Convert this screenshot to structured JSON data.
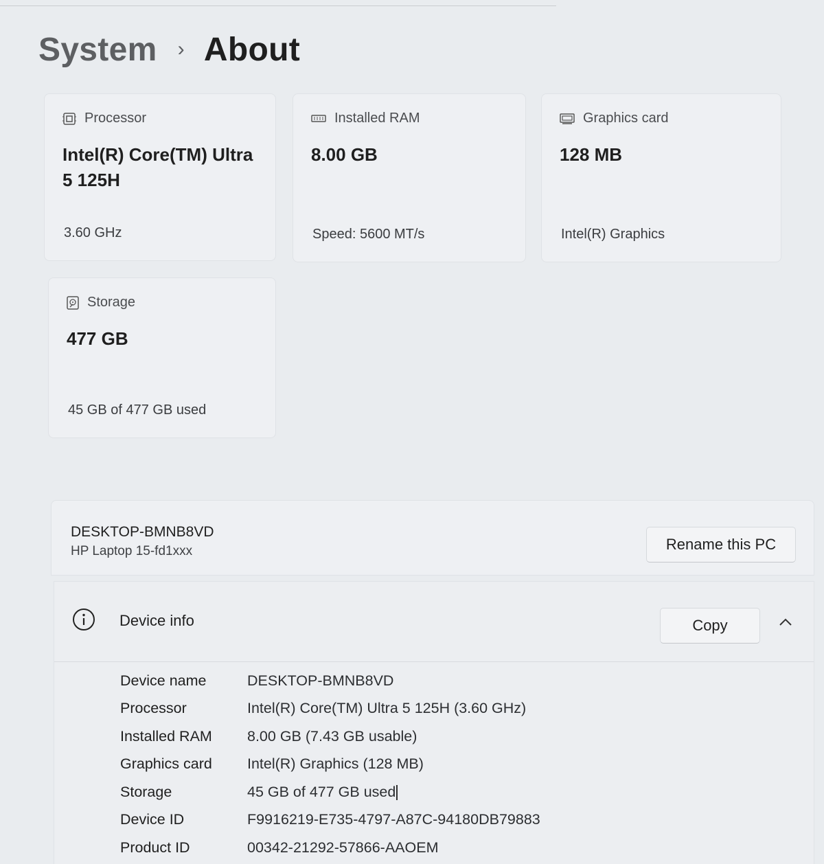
{
  "breadcrumb": {
    "parent": "System",
    "separator": "›",
    "current": "About"
  },
  "specs_cards": [
    {
      "icon": "processor-icon",
      "label": "Processor",
      "value": "Intel(R) Core(TM) Ultra 5 125H",
      "sub": "3.60 GHz"
    },
    {
      "icon": "ram-icon",
      "label": "Installed RAM",
      "value": "8.00 GB",
      "sub": "Speed: 5600 MT/s"
    },
    {
      "icon": "graphics-card-icon",
      "label": "Graphics card",
      "value": "128 MB",
      "sub": "Intel(R) Graphics"
    },
    {
      "icon": "storage-icon",
      "label": "Storage",
      "value": "477 GB",
      "sub": "45 GB of 477 GB used"
    }
  ],
  "pc": {
    "name": "DESKTOP-BMNB8VD",
    "model": "HP Laptop 15-fd1xxx",
    "rename_label": "Rename this PC"
  },
  "device_info": {
    "title": "Device info",
    "copy_label": "Copy",
    "rows": [
      {
        "label": "Device name",
        "value": "DESKTOP-BMNB8VD"
      },
      {
        "label": "Processor",
        "value": "Intel(R) Core(TM) Ultra 5 125H (3.60 GHz)"
      },
      {
        "label": "Installed RAM",
        "value": "8.00 GB (7.43 GB usable)"
      },
      {
        "label": "Graphics card",
        "value": "Intel(R) Graphics (128 MB)"
      },
      {
        "label": "Storage",
        "value": "45 GB of 477 GB used"
      },
      {
        "label": "Device ID",
        "value": "F9916219-E735-4797-A87C-94180DB79883"
      },
      {
        "label": "Product ID",
        "value": "00342-21292-57866-AAOEM"
      }
    ]
  }
}
